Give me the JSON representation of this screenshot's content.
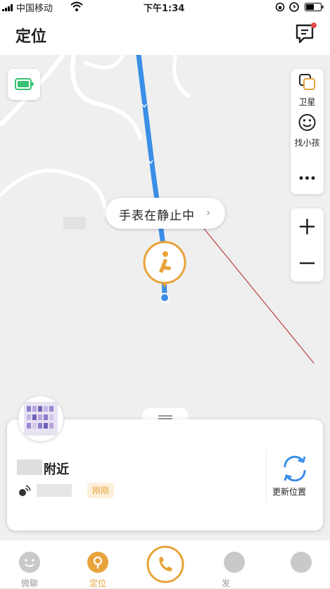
{
  "status_bar": {
    "carrier": "中国移动",
    "time": "下午1:34"
  },
  "header": {
    "title": "定位"
  },
  "map": {
    "side_panel": {
      "satellite_label": "卫星",
      "find_child_label": "找小孩"
    },
    "bubble": {
      "text": "手表在静止中"
    }
  },
  "sheet": {
    "place_text": "附近",
    "time_badge": "刚刚",
    "refresh_label": "更新位置"
  },
  "tabbar": {
    "tab1": "微聊",
    "tab2": "定位",
    "tab4": "发"
  },
  "colors": {
    "route": "#3a8ee6",
    "accent": "#e8a33a",
    "battery": "#38c172"
  }
}
